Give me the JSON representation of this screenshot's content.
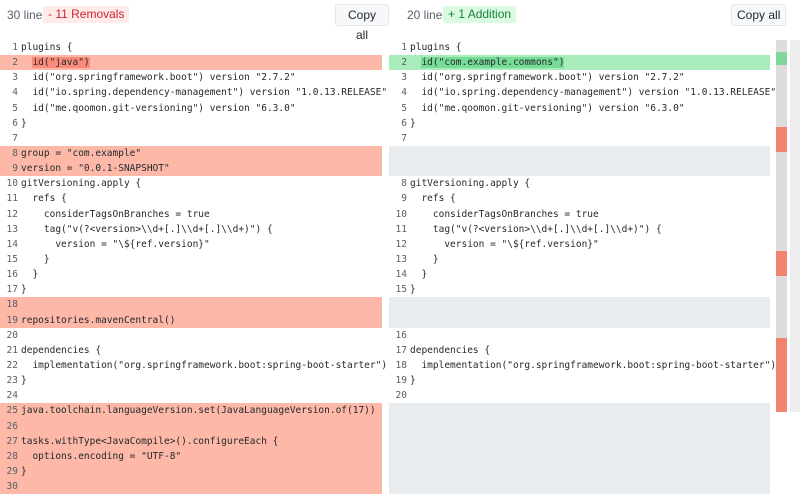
{
  "left": {
    "line_count": "30 lines",
    "badge": "- 11 Removals",
    "copy_label": "Copy all",
    "lines": [
      {
        "n": "1",
        "t": "plugins {",
        "k": "normal"
      },
      {
        "n": "2",
        "t": "  id(\"java\")",
        "k": "removed",
        "hl": "id(\"java\")"
      },
      {
        "n": "3",
        "t": "  id(\"org.springframework.boot\") version \"2.7.2\"",
        "k": "normal"
      },
      {
        "n": "4",
        "t": "  id(\"io.spring.dependency-management\") version \"1.0.13.RELEASE\"",
        "k": "normal"
      },
      {
        "n": "5",
        "t": "  id(\"me.qoomon.git-versioning\") version \"6.3.0\"",
        "k": "normal"
      },
      {
        "n": "6",
        "t": "}",
        "k": "normal"
      },
      {
        "n": "7",
        "t": "",
        "k": "normal"
      },
      {
        "n": "8",
        "t": "group = \"com.example\"",
        "k": "removed"
      },
      {
        "n": "9",
        "t": "version = \"0.0.1-SNAPSHOT\"",
        "k": "removed"
      },
      {
        "n": "10",
        "t": "gitVersioning.apply {",
        "k": "normal"
      },
      {
        "n": "11",
        "t": "  refs {",
        "k": "normal"
      },
      {
        "n": "12",
        "t": "    considerTagsOnBranches = true",
        "k": "normal"
      },
      {
        "n": "13",
        "t": "    tag(\"v(?<version>\\\\d+[.]\\\\d+[.]\\\\d+)\") {",
        "k": "normal"
      },
      {
        "n": "14",
        "t": "      version = \"\\${ref.version}\"",
        "k": "normal"
      },
      {
        "n": "15",
        "t": "    }",
        "k": "normal"
      },
      {
        "n": "16",
        "t": "  }",
        "k": "normal"
      },
      {
        "n": "17",
        "t": "}",
        "k": "normal"
      },
      {
        "n": "18",
        "t": "",
        "k": "removed"
      },
      {
        "n": "19",
        "t": "repositories.mavenCentral()",
        "k": "removed"
      },
      {
        "n": "20",
        "t": "",
        "k": "normal"
      },
      {
        "n": "21",
        "t": "dependencies {",
        "k": "normal"
      },
      {
        "n": "22",
        "t": "  implementation(\"org.springframework.boot:spring-boot-starter\")",
        "k": "normal"
      },
      {
        "n": "23",
        "t": "}",
        "k": "normal"
      },
      {
        "n": "24",
        "t": "",
        "k": "normal"
      },
      {
        "n": "25",
        "t": "java.toolchain.languageVersion.set(JavaLanguageVersion.of(17))",
        "k": "removed"
      },
      {
        "n": "26",
        "t": "",
        "k": "removed"
      },
      {
        "n": "27",
        "t": "tasks.withType<JavaCompile>().configureEach {",
        "k": "removed"
      },
      {
        "n": "28",
        "t": "  options.encoding = \"UTF-8\"",
        "k": "removed"
      },
      {
        "n": "29",
        "t": "}",
        "k": "removed"
      },
      {
        "n": "30",
        "t": "",
        "k": "removed"
      }
    ]
  },
  "right": {
    "line_count": "20 lines",
    "badge": "+ 1 Addition",
    "copy_label": "Copy all",
    "lines": [
      {
        "n": "1",
        "t": "plugins {",
        "k": "normal"
      },
      {
        "n": "2",
        "t": "  id(\"com.example.commons\")",
        "k": "added",
        "hl": "id(\"com.example.commons\")"
      },
      {
        "n": "3",
        "t": "  id(\"org.springframework.boot\") version \"2.7.2\"",
        "k": "normal"
      },
      {
        "n": "4",
        "t": "  id(\"io.spring.dependency-management\") version \"1.0.13.RELEASE\"",
        "k": "normal"
      },
      {
        "n": "5",
        "t": "  id(\"me.qoomon.git-versioning\") version \"6.3.0\"",
        "k": "normal"
      },
      {
        "n": "6",
        "t": "}",
        "k": "normal"
      },
      {
        "n": "7",
        "t": "",
        "k": "normal"
      },
      {
        "n": "",
        "t": "",
        "k": "empty"
      },
      {
        "n": "",
        "t": "",
        "k": "empty"
      },
      {
        "n": "8",
        "t": "gitVersioning.apply {",
        "k": "normal"
      },
      {
        "n": "9",
        "t": "  refs {",
        "k": "normal"
      },
      {
        "n": "10",
        "t": "    considerTagsOnBranches = true",
        "k": "normal"
      },
      {
        "n": "11",
        "t": "    tag(\"v(?<version>\\\\d+[.]\\\\d+[.]\\\\d+)\") {",
        "k": "normal"
      },
      {
        "n": "12",
        "t": "      version = \"\\${ref.version}\"",
        "k": "normal"
      },
      {
        "n": "13",
        "t": "    }",
        "k": "normal"
      },
      {
        "n": "14",
        "t": "  }",
        "k": "normal"
      },
      {
        "n": "15",
        "t": "}",
        "k": "normal"
      },
      {
        "n": "",
        "t": "",
        "k": "empty"
      },
      {
        "n": "",
        "t": "",
        "k": "empty"
      },
      {
        "n": "16",
        "t": "",
        "k": "normal"
      },
      {
        "n": "17",
        "t": "dependencies {",
        "k": "normal"
      },
      {
        "n": "18",
        "t": "  implementation(\"org.springframework.boot:spring-boot-starter\")",
        "k": "normal"
      },
      {
        "n": "19",
        "t": "}",
        "k": "normal"
      },
      {
        "n": "20",
        "t": "",
        "k": "normal"
      },
      {
        "n": "",
        "t": "",
        "k": "empty"
      },
      {
        "n": "",
        "t": "",
        "k": "empty"
      },
      {
        "n": "",
        "t": "",
        "k": "empty"
      },
      {
        "n": "",
        "t": "",
        "k": "empty"
      },
      {
        "n": "",
        "t": "",
        "k": "empty"
      },
      {
        "n": "",
        "t": "",
        "k": "empty"
      }
    ]
  },
  "colors": {
    "removed_line": "#fdb8a8",
    "removed_highlight": "#fb8c7a",
    "added_line": "#a8ecbb",
    "added_highlight": "#76dd97",
    "empty_line": "#e9ecef"
  }
}
